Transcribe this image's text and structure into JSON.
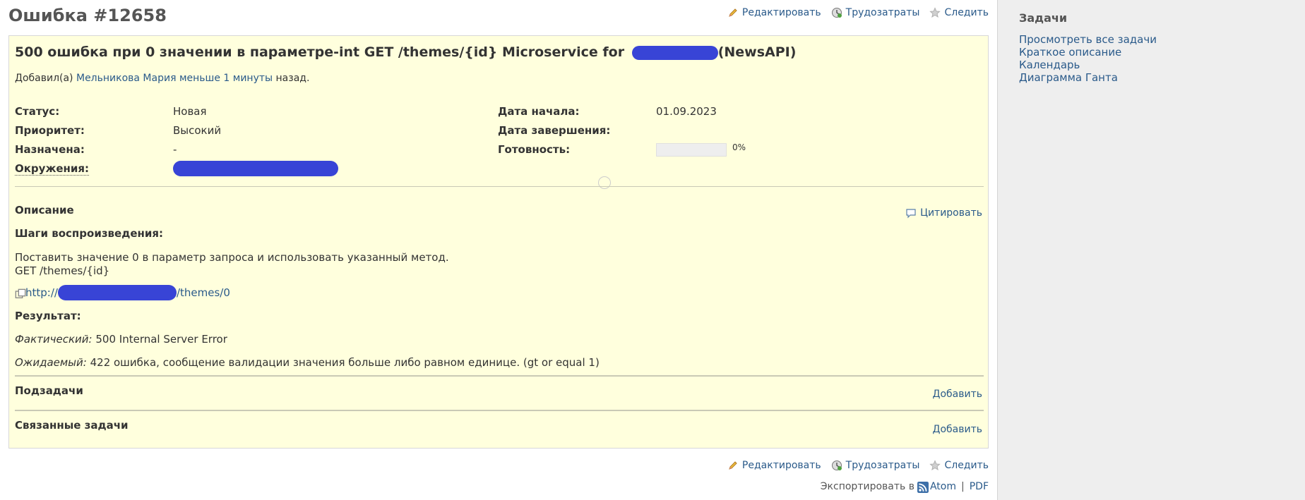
{
  "page": {
    "title": "Ошибка #12658"
  },
  "actions": {
    "edit": "Редактировать",
    "time": "Трудозатраты",
    "watch": "Следить"
  },
  "issue": {
    "subject_before": "500 ошибка при 0 значении в параметре-int GET /themes/{id} Microservice for",
    "subject_after": "(NewsAPI)",
    "author_prefix": "Добавил(а)",
    "author_name": "Мельникова Мария",
    "author_time": "меньше 1 минуты",
    "author_suffix": "назад.",
    "attributes": {
      "status_label": "Статус:",
      "status_value": "Новая",
      "priority_label": "Приоритет:",
      "priority_value": "Высокий",
      "assigned_label": "Назначена:",
      "assigned_value": "-",
      "env_label": "Окружения:",
      "start_label": "Дата начала:",
      "start_value": "01.09.2023",
      "due_label": "Дата завершения:",
      "done_label": "Готовность:",
      "done_text": "0%",
      "done_fraction": 0
    },
    "description": {
      "title": "Описание",
      "quote": "Цитировать",
      "steps_title": "Шаги воспроизведения:",
      "steps_line1": "Поставить значение 0 в параметр запроса и использовать указанный метод.",
      "steps_line2": "GET /themes/{id}",
      "url_prefix": "http://",
      "url_suffix": "/themes/0",
      "result_title": "Результат:",
      "actual_label": "Фактический:",
      "actual_value": "500 Internal Server Error",
      "expected_label": "Ожидаемый:",
      "expected_value": "422 ошибка, сообщение валидации значения больше либо равном единице. (gt or equal 1)"
    },
    "subtasks": {
      "title": "Подзадачи",
      "add": "Добавить"
    },
    "relations": {
      "title": "Связанные задачи",
      "add": "Добавить"
    }
  },
  "export": {
    "label": "Экспортировать в",
    "atom": "Atom",
    "separator": "|",
    "pdf": "PDF"
  },
  "sidebar": {
    "title": "Задачи",
    "links": [
      "Просмотреть все задачи",
      "Краткое описание",
      "Календарь",
      "Диаграмма Ганта"
    ]
  },
  "colors": {
    "link": "#2a5a8a",
    "issue_bg": "#ffffdd",
    "sidebar_bg": "#eeeeee",
    "redaction": "#3844d6"
  }
}
